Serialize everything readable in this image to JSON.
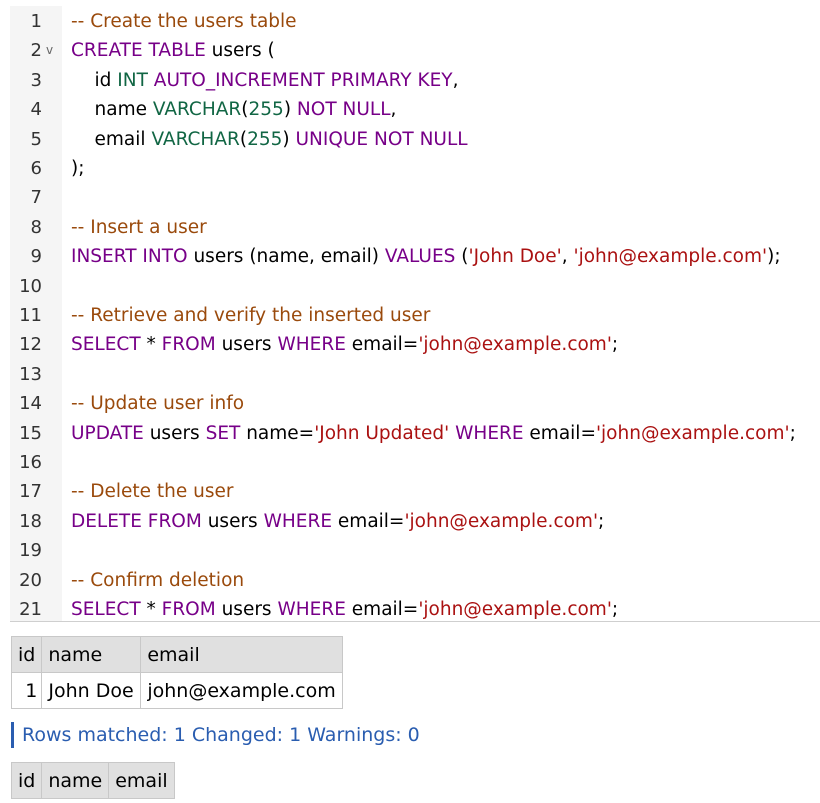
{
  "colors": {
    "comment": "#9a4a0c",
    "keyword": "#770088",
    "type": "#116644",
    "string": "#aa1111",
    "plain": "#000000",
    "status_accent": "#2a5db0",
    "gutter_bg": "#f5f5f5",
    "table_header_bg": "#e0e0e0"
  },
  "editor": {
    "fold_marker": "v",
    "lines": [
      {
        "number": "1",
        "fold": false,
        "tokens": [
          {
            "type": "comment",
            "text": "-- Create the users table"
          }
        ]
      },
      {
        "number": "2",
        "fold": true,
        "tokens": [
          {
            "type": "keyword",
            "text": "CREATE TABLE"
          },
          {
            "type": "plain",
            "text": " users ("
          }
        ]
      },
      {
        "number": "3",
        "fold": false,
        "tokens": [
          {
            "type": "plain",
            "text": "    id "
          },
          {
            "type": "type",
            "text": "INT"
          },
          {
            "type": "plain",
            "text": " "
          },
          {
            "type": "keyword",
            "text": "AUTO_INCREMENT PRIMARY KEY"
          },
          {
            "type": "plain",
            "text": ","
          }
        ]
      },
      {
        "number": "4",
        "fold": false,
        "tokens": [
          {
            "type": "plain",
            "text": "    name "
          },
          {
            "type": "type",
            "text": "VARCHAR"
          },
          {
            "type": "plain",
            "text": "("
          },
          {
            "type": "type",
            "text": "255"
          },
          {
            "type": "plain",
            "text": ") "
          },
          {
            "type": "keyword",
            "text": "NOT NULL"
          },
          {
            "type": "plain",
            "text": ","
          }
        ]
      },
      {
        "number": "5",
        "fold": false,
        "tokens": [
          {
            "type": "plain",
            "text": "    email "
          },
          {
            "type": "type",
            "text": "VARCHAR"
          },
          {
            "type": "plain",
            "text": "("
          },
          {
            "type": "type",
            "text": "255"
          },
          {
            "type": "plain",
            "text": ") "
          },
          {
            "type": "keyword",
            "text": "UNIQUE NOT NULL"
          }
        ]
      },
      {
        "number": "6",
        "fold": false,
        "tokens": [
          {
            "type": "plain",
            "text": ");"
          }
        ]
      },
      {
        "number": "7",
        "fold": false,
        "tokens": []
      },
      {
        "number": "8",
        "fold": false,
        "tokens": [
          {
            "type": "comment",
            "text": "-- Insert a user"
          }
        ]
      },
      {
        "number": "9",
        "fold": false,
        "tokens": [
          {
            "type": "keyword",
            "text": "INSERT INTO"
          },
          {
            "type": "plain",
            "text": " users (name, email) "
          },
          {
            "type": "keyword",
            "text": "VALUES"
          },
          {
            "type": "plain",
            "text": " ("
          },
          {
            "type": "string",
            "text": "'John Doe'"
          },
          {
            "type": "plain",
            "text": ", "
          },
          {
            "type": "string",
            "text": "'john@example.com'"
          },
          {
            "type": "plain",
            "text": ");"
          }
        ]
      },
      {
        "number": "10",
        "fold": false,
        "tokens": []
      },
      {
        "number": "11",
        "fold": false,
        "tokens": [
          {
            "type": "comment",
            "text": "-- Retrieve and verify the inserted user"
          }
        ]
      },
      {
        "number": "12",
        "fold": false,
        "tokens": [
          {
            "type": "keyword",
            "text": "SELECT"
          },
          {
            "type": "plain",
            "text": " * "
          },
          {
            "type": "keyword",
            "text": "FROM"
          },
          {
            "type": "plain",
            "text": " users "
          },
          {
            "type": "keyword",
            "text": "WHERE"
          },
          {
            "type": "plain",
            "text": " email="
          },
          {
            "type": "string",
            "text": "'john@example.com'"
          },
          {
            "type": "plain",
            "text": ";"
          }
        ]
      },
      {
        "number": "13",
        "fold": false,
        "tokens": []
      },
      {
        "number": "14",
        "fold": false,
        "tokens": [
          {
            "type": "comment",
            "text": "-- Update user info"
          }
        ]
      },
      {
        "number": "15",
        "fold": false,
        "tokens": [
          {
            "type": "keyword",
            "text": "UPDATE"
          },
          {
            "type": "plain",
            "text": " users "
          },
          {
            "type": "keyword",
            "text": "SET"
          },
          {
            "type": "plain",
            "text": " name="
          },
          {
            "type": "string",
            "text": "'John Updated'"
          },
          {
            "type": "plain",
            "text": " "
          },
          {
            "type": "keyword",
            "text": "WHERE"
          },
          {
            "type": "plain",
            "text": " email="
          },
          {
            "type": "string",
            "text": "'john@example.com'"
          },
          {
            "type": "plain",
            "text": ";"
          }
        ]
      },
      {
        "number": "16",
        "fold": false,
        "tokens": []
      },
      {
        "number": "17",
        "fold": false,
        "tokens": [
          {
            "type": "comment",
            "text": "-- Delete the user"
          }
        ]
      },
      {
        "number": "18",
        "fold": false,
        "tokens": [
          {
            "type": "keyword",
            "text": "DELETE FROM"
          },
          {
            "type": "plain",
            "text": " users "
          },
          {
            "type": "keyword",
            "text": "WHERE"
          },
          {
            "type": "plain",
            "text": " email="
          },
          {
            "type": "string",
            "text": "'john@example.com'"
          },
          {
            "type": "plain",
            "text": ";"
          }
        ]
      },
      {
        "number": "19",
        "fold": false,
        "tokens": []
      },
      {
        "number": "20",
        "fold": false,
        "tokens": [
          {
            "type": "comment",
            "text": "-- Confirm deletion"
          }
        ]
      },
      {
        "number": "21",
        "fold": false,
        "tokens": [
          {
            "type": "keyword",
            "text": "SELECT"
          },
          {
            "type": "plain",
            "text": " * "
          },
          {
            "type": "keyword",
            "text": "FROM"
          },
          {
            "type": "plain",
            "text": " users "
          },
          {
            "type": "keyword",
            "text": "WHERE"
          },
          {
            "type": "plain",
            "text": " email="
          },
          {
            "type": "string",
            "text": "'john@example.com'"
          },
          {
            "type": "plain",
            "text": ";"
          }
        ]
      }
    ]
  },
  "results": {
    "table1": {
      "headers": [
        "id",
        "name",
        "email"
      ],
      "rows": [
        [
          "1",
          "John Doe",
          "john@example.com"
        ]
      ]
    },
    "status_message": "Rows matched: 1  Changed: 1  Warnings: 0",
    "table2": {
      "headers": [
        "id",
        "name",
        "email"
      ],
      "rows": []
    }
  }
}
